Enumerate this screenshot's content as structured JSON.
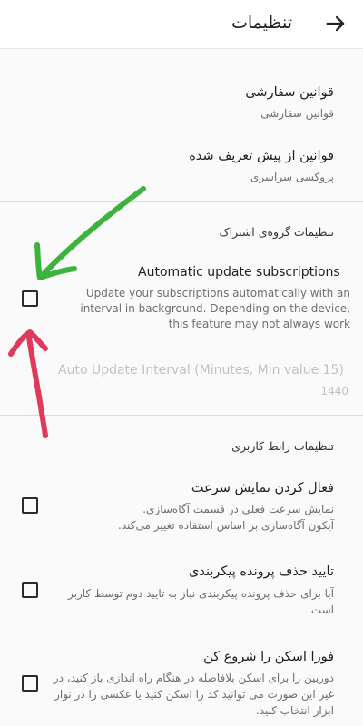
{
  "header": {
    "title": "تنظیمات",
    "back_icon": "arrow-right-icon"
  },
  "rules": [
    {
      "title": "قوانین سفارشی",
      "summary": "قوانین سفارشی"
    },
    {
      "title": "قوانین از پیش تعریف شده",
      "summary": "پروکسی سراسری"
    }
  ],
  "subscription_group": {
    "header": "تنظیمات گروه‌ی اشتراک",
    "auto_update": {
      "title": "Automatic update subscriptions",
      "summary_lines": [
        "Update your subscriptions automatically with an",
        "interval in background. Depending on the device,",
        "this feature may not always work"
      ],
      "checked": false
    },
    "interval": {
      "title": "Auto Update Interval (Minutes, Min value 15)",
      "value": "1440",
      "enabled": false
    }
  },
  "ui_group": {
    "header": "تنظیمات رابط کاربری",
    "items": [
      {
        "title": "فعال کردن نمایش سرعت",
        "summary_lines": [
          "نمایش سرعت فعلی در قسمت آگاه‌سازی.",
          "آیکون آگاه‌سازی بر اساس استفاده تغییر می‌کند."
        ],
        "checked": false
      },
      {
        "title": "تایید حذف پرونده پیکربندی",
        "summary_lines": [
          "آیا برای حذف پرونده پیکربندی نیاز به تایید دوم توسط کاربر",
          "است"
        ],
        "checked": false
      },
      {
        "title": "فورا اسکن را شروع کن",
        "summary_lines": [
          "دوربین را برای اسکن بلافاصله در هنگام راه اندازی باز کنید، در",
          "غیر این صورت می توانید کد را اسکن کنید یا عکسی را در نوار",
          "ابزار انتخاب کنید."
        ],
        "checked": false
      }
    ]
  },
  "annotations": {
    "green_arrow_color": "#3cb33c",
    "red_arrow_color": "#e03a5a"
  }
}
